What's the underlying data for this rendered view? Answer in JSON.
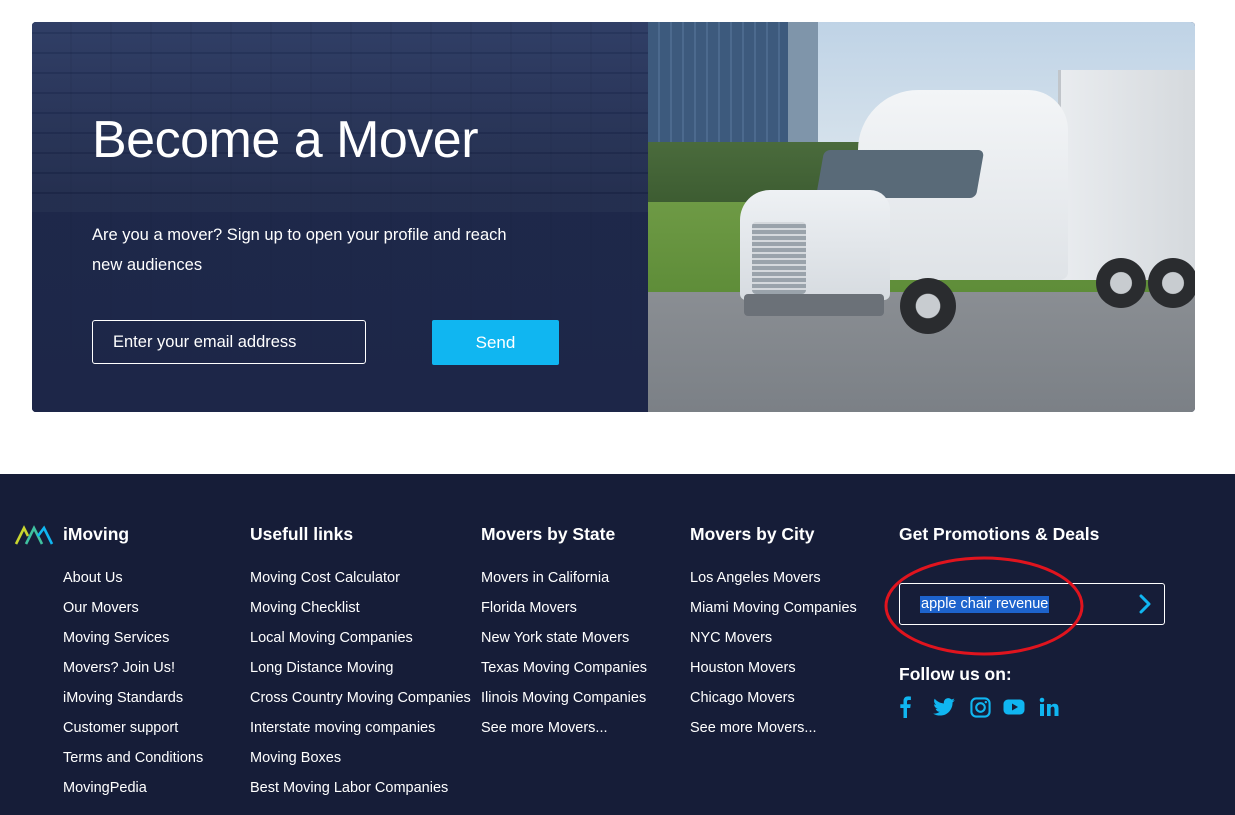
{
  "hero": {
    "title": "Become a Mover",
    "text": "Are you a mover? Sign up to open your profile and reach new audiences",
    "email_placeholder": "Enter your email address",
    "send_label": "Send"
  },
  "footer": {
    "brand": "iMoving",
    "columns": [
      {
        "heading": "iMoving",
        "links": [
          "About Us",
          "Our Movers",
          "Moving Services",
          "Movers? Join Us!",
          "iMoving Standards",
          "Customer support",
          "Terms and Conditions",
          "MovingPedia"
        ]
      },
      {
        "heading": "Usefull links",
        "links": [
          "Moving Cost Calculator",
          "Moving Checklist",
          "Local Moving Companies",
          "Long Distance Moving",
          "Cross Country Moving Companies",
          "Interstate moving companies",
          "Moving Boxes",
          "Best Moving Labor Companies"
        ]
      },
      {
        "heading": "Movers by State",
        "links": [
          "Movers in California",
          "Florida Movers",
          "New York state Movers",
          "Texas Moving Companies",
          "Ilinois Moving Companies",
          "See more Movers..."
        ]
      },
      {
        "heading": "Movers by City",
        "links": [
          "Los Angeles Movers",
          "Miami Moving Companies",
          "NYC Movers",
          "Houston Movers",
          "Chicago Movers",
          "See more Movers..."
        ]
      }
    ],
    "promotions": {
      "heading": "Get Promotions & Deals",
      "input_value": "apple chair revenue"
    },
    "follow_label": "Follow us on:",
    "social": [
      "facebook-icon",
      "twitter-icon",
      "instagram-icon",
      "youtube-icon",
      "linkedin-icon"
    ]
  },
  "colors": {
    "accent": "#10b6f1",
    "footer_bg": "#161d38",
    "selection": "#1d63cc",
    "annotation": "#e0141e"
  }
}
